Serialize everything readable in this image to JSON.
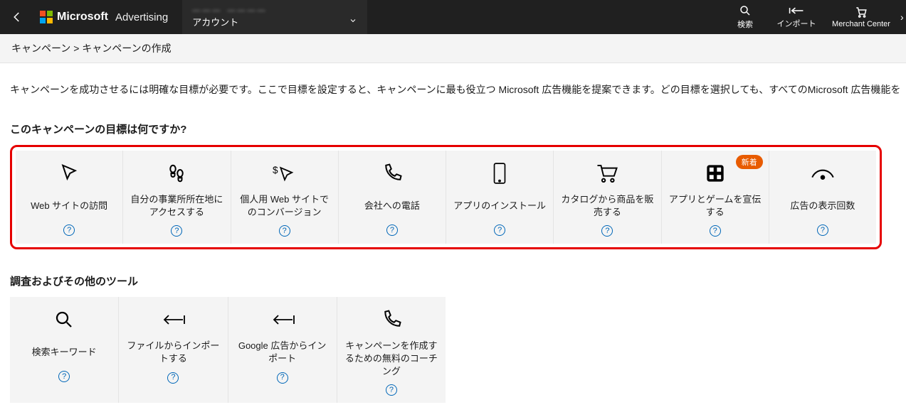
{
  "header": {
    "brand": "Microsoft",
    "product": "Advertising",
    "account_label": "アカウント",
    "account_name": "",
    "search_label": "検索",
    "import_label": "インポート",
    "merchant_label": "Merchant Center"
  },
  "breadcrumb": {
    "item1": "キャンペーン",
    "sep": " > ",
    "item2": "キャンペーンの作成"
  },
  "intro": "キャンペーンを成功させるには明確な目標が必要です。ここで目標を設定すると、キャンペーンに最も役立つ Microsoft 広告機能を提案できます。どの目標を選択しても、すべてのMicrosoft 広告機能を",
  "goals": {
    "heading": "このキャンペーンの目標は何ですか?",
    "items": [
      {
        "label": "Web サイトの訪問"
      },
      {
        "label": "自分の事業所所在地にアクセスする"
      },
      {
        "label": "個人用 Web サイトでのコンバージョン"
      },
      {
        "label": "会社への電話"
      },
      {
        "label": "アプリのインストール"
      },
      {
        "label": "カタログから商品を販売する"
      },
      {
        "label": "アプリとゲームを宣伝する",
        "badge": "新着"
      },
      {
        "label": "広告の表示回数"
      }
    ]
  },
  "tools": {
    "heading": "調査およびその他のツール",
    "items": [
      {
        "label": "検索キーワード"
      },
      {
        "label": "ファイルからインポートする"
      },
      {
        "label": "Google 広告からインポート"
      },
      {
        "label": "キャンペーンを作成するための無料のコーチング"
      }
    ]
  }
}
